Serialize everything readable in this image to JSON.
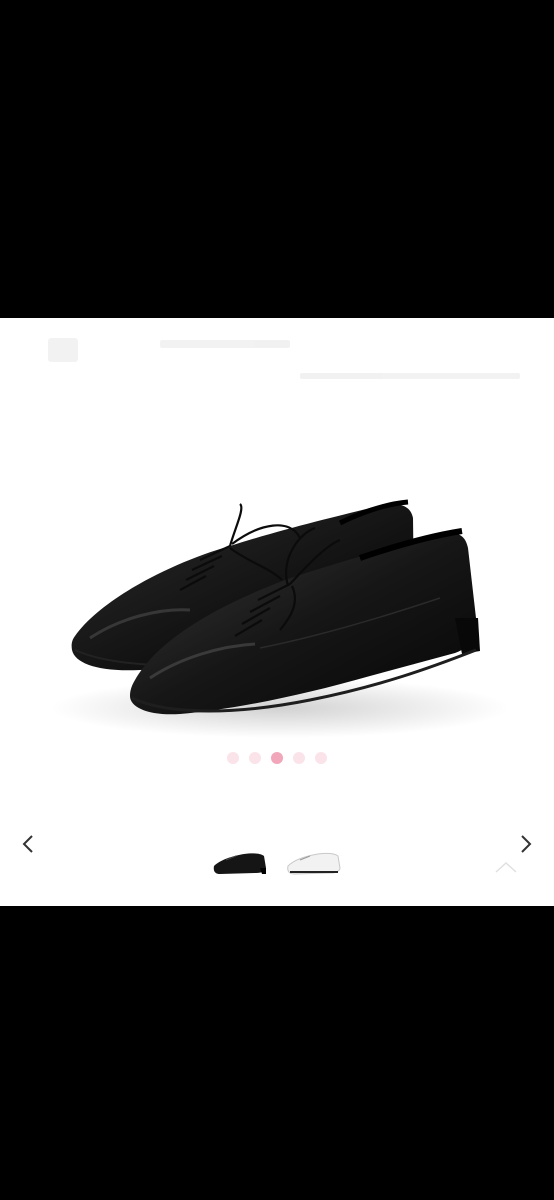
{
  "viewer": {
    "product_image": "black-leather-oxford-shoes",
    "dots": {
      "count": 5,
      "active_index": 2,
      "color": "#fbe3ea",
      "active_color": "#f1a6ba"
    },
    "thumbnails": [
      {
        "variant": "black",
        "name": "thumb-black-shoe"
      },
      {
        "variant": "white",
        "name": "thumb-white-shoe"
      }
    ],
    "icons": {
      "prev": "chevron-left-icon",
      "next": "chevron-right-icon",
      "scroll_top": "chevron-up-icon"
    }
  }
}
